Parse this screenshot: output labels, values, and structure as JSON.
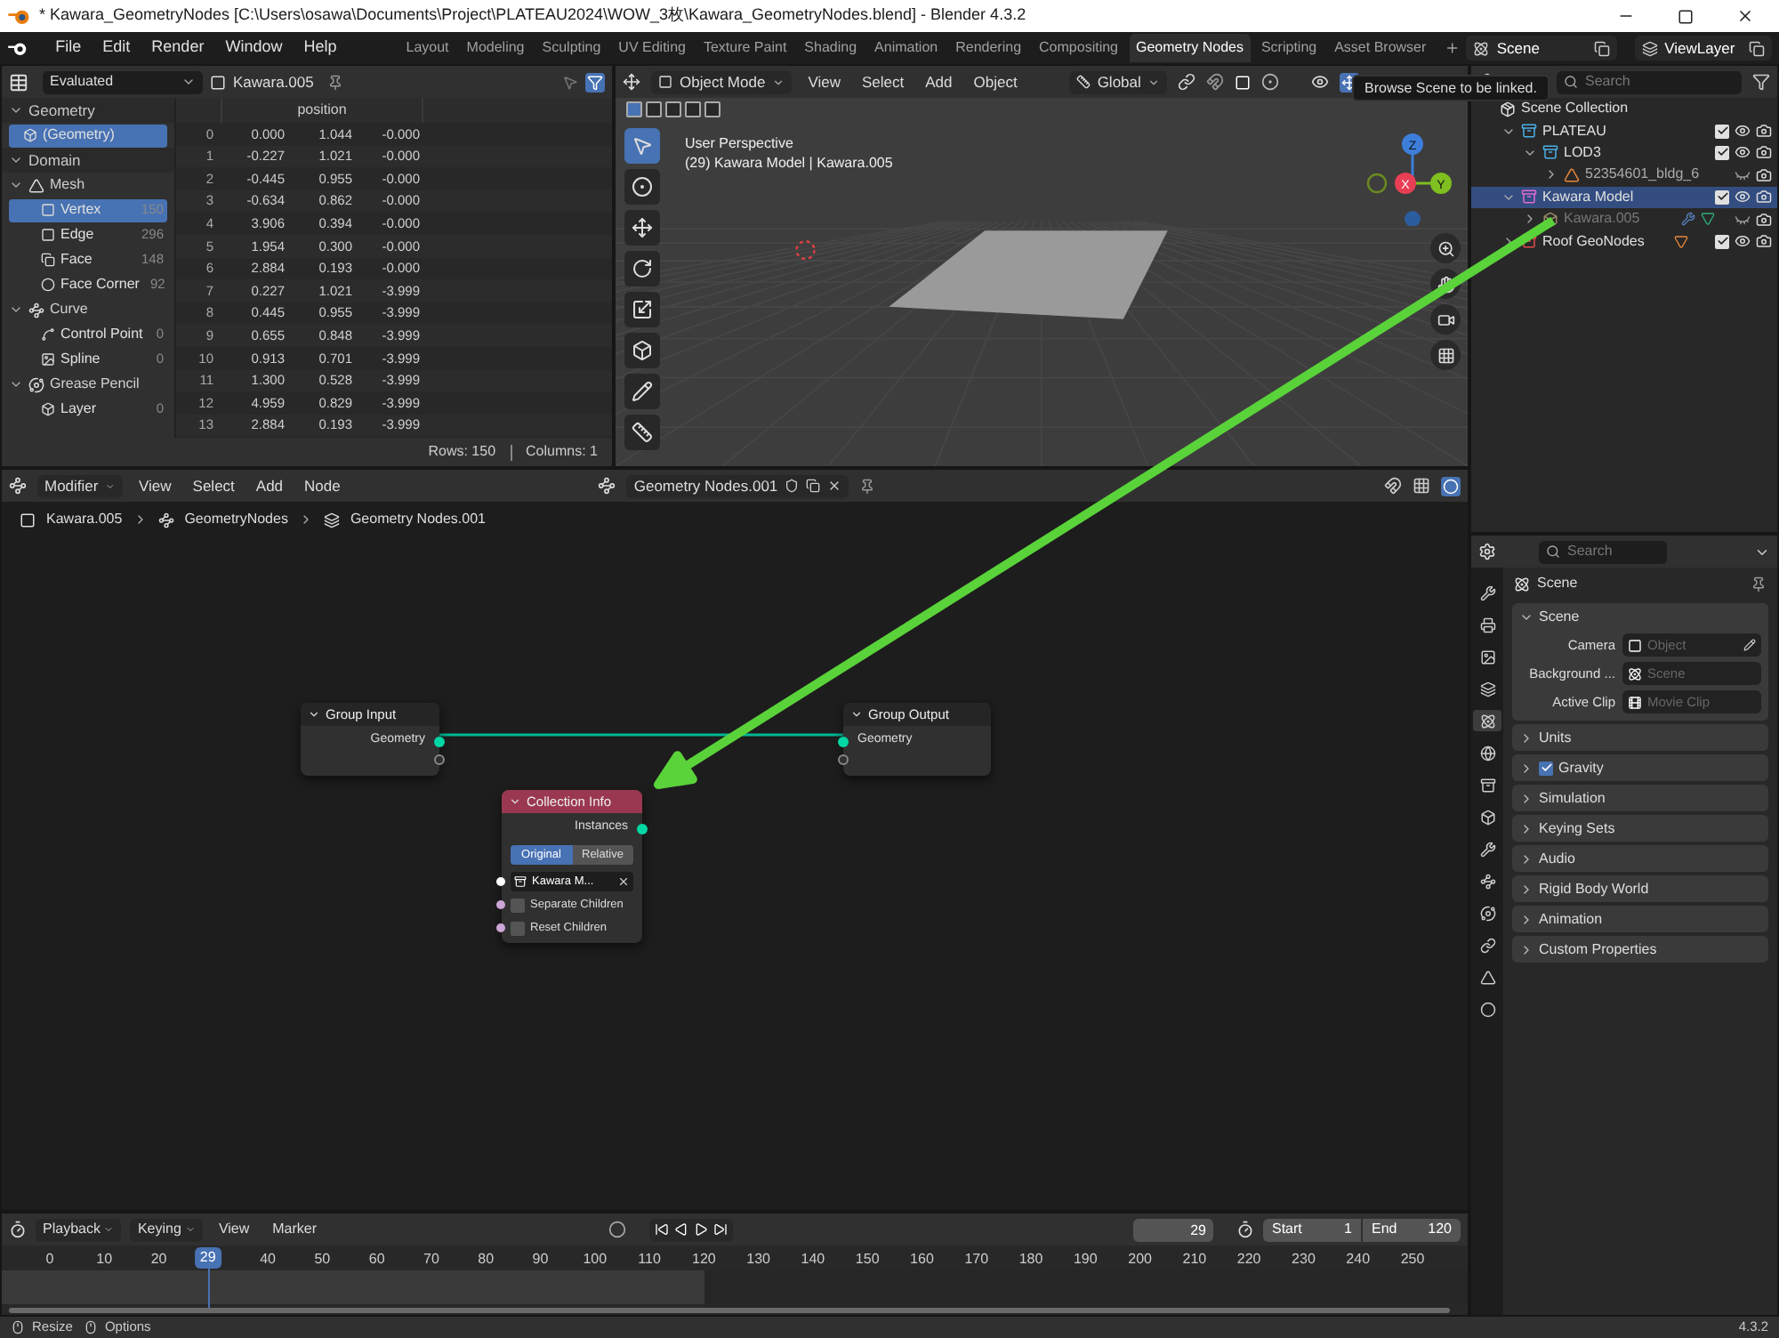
{
  "window": {
    "title": "* Kawara_GeometryNodes [C:\\Users\\osawa\\Documents\\Project\\PLATEAU2024\\WOW_3枚\\Kawara_GeometryNodes.blend] - Blender 4.3.2"
  },
  "menu": [
    "File",
    "Edit",
    "Render",
    "Window",
    "Help"
  ],
  "workspaces": [
    {
      "label": "Layout",
      "selected": false
    },
    {
      "label": "Modeling",
      "selected": false
    },
    {
      "label": "Sculpting",
      "selected": false
    },
    {
      "label": "UV Editing",
      "selected": false
    },
    {
      "label": "Texture Paint",
      "selected": false
    },
    {
      "label": "Shading",
      "selected": false
    },
    {
      "label": "Animation",
      "selected": false
    },
    {
      "label": "Rendering",
      "selected": false
    },
    {
      "label": "Compositing",
      "selected": false
    },
    {
      "label": "Geometry Nodes",
      "selected": true
    },
    {
      "label": "Scripting",
      "selected": false
    },
    {
      "label": "Asset Browser",
      "selected": false
    }
  ],
  "scene": "Scene",
  "view_layer": "ViewLayer",
  "tooltip": "Browse Scene to be linked.",
  "spreadsheet": {
    "mode": "Evaluated",
    "object": "Kawara.005",
    "tree": [
      {
        "label": "Geometry",
        "kind": "section",
        "expanded": true,
        "children": [
          {
            "label": "(Geometry)",
            "kind": "leaf",
            "selected": true
          }
        ]
      },
      {
        "label": "Domain",
        "kind": "section",
        "expanded": true,
        "children": [
          {
            "label": "Mesh",
            "kind": "group",
            "expanded": true,
            "children": [
              {
                "label": "Vertex",
                "kind": "leaf",
                "count": "150",
                "selected": true
              },
              {
                "label": "Edge",
                "kind": "leaf",
                "count": "296",
                "selected": false
              },
              {
                "label": "Face",
                "kind": "leaf",
                "count": "148",
                "selected": false
              },
              {
                "label": "Face Corner",
                "kind": "leaf",
                "count": "92",
                "selected": false
              }
            ]
          },
          {
            "label": "Curve",
            "kind": "group",
            "expanded": true,
            "children": [
              {
                "label": "Control Point",
                "kind": "leaf",
                "count": "0",
                "selected": false
              },
              {
                "label": "Spline",
                "kind": "leaf",
                "count": "0",
                "selected": false
              }
            ]
          },
          {
            "label": "Grease Pencil",
            "kind": "group",
            "expanded": true,
            "children": [
              {
                "label": "Layer",
                "kind": "leaf",
                "count": "0",
                "selected": false
              }
            ]
          }
        ]
      }
    ],
    "column": "position",
    "rows": [
      {
        "index": "0",
        "values": [
          "0.000",
          "1.044",
          "-0.000"
        ]
      },
      {
        "index": "1",
        "values": [
          "-0.227",
          "1.021",
          "-0.000"
        ]
      },
      {
        "index": "2",
        "values": [
          "-0.445",
          "0.955",
          "-0.000"
        ]
      },
      {
        "index": "3",
        "values": [
          "-0.634",
          "0.862",
          "-0.000"
        ]
      },
      {
        "index": "4",
        "values": [
          "3.906",
          "0.394",
          "-0.000"
        ]
      },
      {
        "index": "5",
        "values": [
          "1.954",
          "0.300",
          "-0.000"
        ]
      },
      {
        "index": "6",
        "values": [
          "2.884",
          "0.193",
          "-0.000"
        ]
      },
      {
        "index": "7",
        "values": [
          "0.227",
          "1.021",
          "-3.999"
        ]
      },
      {
        "index": "8",
        "values": [
          "0.445",
          "0.955",
          "-3.999"
        ]
      },
      {
        "index": "9",
        "values": [
          "0.655",
          "0.848",
          "-3.999"
        ]
      },
      {
        "index": "10",
        "values": [
          "0.913",
          "0.701",
          "-3.999"
        ]
      },
      {
        "index": "11",
        "values": [
          "1.300",
          "0.528",
          "-3.999"
        ]
      },
      {
        "index": "12",
        "values": [
          "4.959",
          "0.829",
          "-3.999"
        ]
      },
      {
        "index": "13",
        "values": [
          "2.884",
          "0.193",
          "-3.999"
        ]
      }
    ],
    "footer": [
      "Rows: 150",
      "Columns: 1"
    ]
  },
  "viewport": {
    "mode": "Object Mode",
    "menus": [
      "View",
      "Select",
      "Add",
      "Object"
    ],
    "orientation": "Global",
    "overlay_lines": [
      "User Perspective",
      "(29) Kawara Model | Kawara.005"
    ],
    "axes": [
      "Z",
      "X",
      "Y"
    ]
  },
  "outliner": {
    "search_placeholder": "Search",
    "root": "Scene Collection",
    "items": [
      {
        "label": "PLATEAU",
        "kind": "collection",
        "expanded": true,
        "selected": false,
        "checked": true,
        "visible": true,
        "disabled": false,
        "children": [
          {
            "label": "LOD3",
            "kind": "collection",
            "expanded": true,
            "selected": false,
            "checked": true,
            "visible": true,
            "disabled": false,
            "children": [
              {
                "label": "52354601_bldg_6",
                "kind": "mesh",
                "expanded": false,
                "selected": false,
                "visible": false,
                "disabled": false
              }
            ]
          }
        ]
      },
      {
        "label": "Kawara Model",
        "kind": "collection",
        "expanded": true,
        "selected": true,
        "checked": true,
        "visible": true,
        "disabled": false,
        "children": [
          {
            "label": "Kawara.005",
            "kind": "object",
            "expanded": false,
            "selected": false,
            "visible": false,
            "disabled": true
          }
        ]
      },
      {
        "label": "Roof GeoNodes",
        "kind": "tagged",
        "expanded": false,
        "selected": false,
        "checked": true,
        "visible": true,
        "disabled": false
      }
    ]
  },
  "node_editor": {
    "context": "Modifier",
    "menus": [
      "View",
      "Select",
      "Add",
      "Node"
    ],
    "node_group": "Geometry Nodes.001",
    "breadcrumbs": [
      "Kawara.005",
      "GeometryNodes",
      "Geometry Nodes.001"
    ],
    "nodes": [
      {
        "kind": "group_input",
        "title": "Group Input",
        "sockets": [
          "Geometry"
        ]
      },
      {
        "kind": "group_output",
        "title": "Group Output",
        "sockets": [
          "Geometry"
        ]
      },
      {
        "kind": "collection_info",
        "title": "Collection Info",
        "sockets": [
          "Instances"
        ],
        "toggle": [
          {
            "label": "Original",
            "selected": true
          },
          {
            "label": "Relative",
            "selected": false
          }
        ],
        "collection": "Kawara M...",
        "options": [
          {
            "label": "Separate Children",
            "checked": false
          },
          {
            "label": "Reset Children",
            "checked": false
          }
        ]
      }
    ]
  },
  "properties": {
    "search_placeholder": "Search",
    "context": "Scene",
    "panels": [
      {
        "label": "Scene",
        "expanded": true,
        "fields": [
          {
            "label": "Camera",
            "placeholder": "Object"
          },
          {
            "label": "Background ...",
            "placeholder": "Scene"
          },
          {
            "label": "Active Clip",
            "placeholder": "Movie Clip"
          }
        ]
      },
      {
        "label": "Units",
        "expanded": false
      },
      {
        "label": "Gravity",
        "expanded": false,
        "checked": true
      },
      {
        "label": "Simulation",
        "expanded": false
      },
      {
        "label": "Keying Sets",
        "expanded": false
      },
      {
        "label": "Audio",
        "expanded": false
      },
      {
        "label": "Rigid Body World",
        "expanded": false
      },
      {
        "label": "Animation",
        "expanded": false
      },
      {
        "label": "Custom Properties",
        "expanded": false
      }
    ]
  },
  "timeline": {
    "menus": [
      "Playback",
      "Keying",
      "View",
      "Marker"
    ],
    "current_frame": "29",
    "start_label": "Start",
    "start": "1",
    "end_label": "End",
    "end": "120",
    "playhead": "29",
    "ticks": [
      "0",
      "10",
      "20",
      "40",
      "50",
      "60",
      "70",
      "80",
      "90",
      "100",
      "110",
      "120",
      "130",
      "140",
      "150",
      "160",
      "170",
      "180",
      "190",
      "200",
      "210",
      "220",
      "230",
      "240",
      "250"
    ]
  },
  "status_bar": {
    "hints": [
      "Resize",
      "Options"
    ],
    "version": "4.3.2"
  }
}
